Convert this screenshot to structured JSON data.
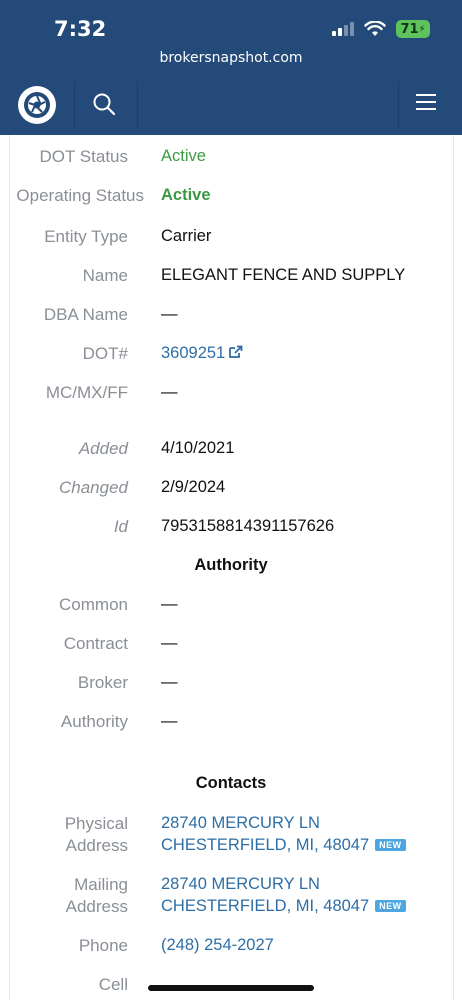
{
  "status_bar": {
    "time": "7:32",
    "battery": "71"
  },
  "browser": {
    "url": "brokersnapshot.com"
  },
  "nav": {
    "logo_icon": "camera-shutter-icon",
    "search_icon": "search-icon",
    "menu_icon": "hamburger-menu-icon"
  },
  "fields": {
    "dot_status": {
      "label": "DOT Status",
      "value": "Active"
    },
    "operating_status": {
      "label": "Operating Status",
      "value": "Active"
    },
    "entity_type": {
      "label": "Entity Type",
      "value": "Carrier"
    },
    "name": {
      "label": "Name",
      "value": "ELEGANT FENCE AND SUPPLY"
    },
    "dba_name": {
      "label": "DBA Name",
      "value": "—"
    },
    "dot_number": {
      "label": "DOT#",
      "value": "3609251"
    },
    "mc_mx_ff": {
      "label": "MC/MX/FF",
      "value": "—"
    },
    "added": {
      "label": "Added",
      "value": "4/10/2021"
    },
    "changed": {
      "label": "Changed",
      "value": "2/9/2024"
    },
    "id": {
      "label": "Id",
      "value": "7953158814391157626"
    }
  },
  "authority": {
    "title": "Authority",
    "common": {
      "label": "Common",
      "value": "—"
    },
    "contract": {
      "label": "Contract",
      "value": "—"
    },
    "broker": {
      "label": "Broker",
      "value": "—"
    },
    "authority": {
      "label": "Authority",
      "value": "—"
    }
  },
  "contacts": {
    "title": "Contacts",
    "physical": {
      "label_1": "Physical",
      "label_2": "Address",
      "line_1": "28740 MERCURY LN",
      "line_2": "CHESTERFIELD, MI, 48047",
      "badge": "NEW"
    },
    "mailing": {
      "label_1": "Mailing",
      "label_2": "Address",
      "line_1": "28740 MERCURY LN",
      "line_2": "CHESTERFIELD, MI, 48047",
      "badge": "NEW"
    },
    "phone": {
      "label": "Phone",
      "value": "(248) 254-2027"
    },
    "cell": {
      "label": "Cell"
    }
  },
  "colors": {
    "header": "#244a79",
    "active_green": "#3c9a43",
    "link_blue": "#2d6ea6",
    "badge_blue": "#4da6e0"
  }
}
